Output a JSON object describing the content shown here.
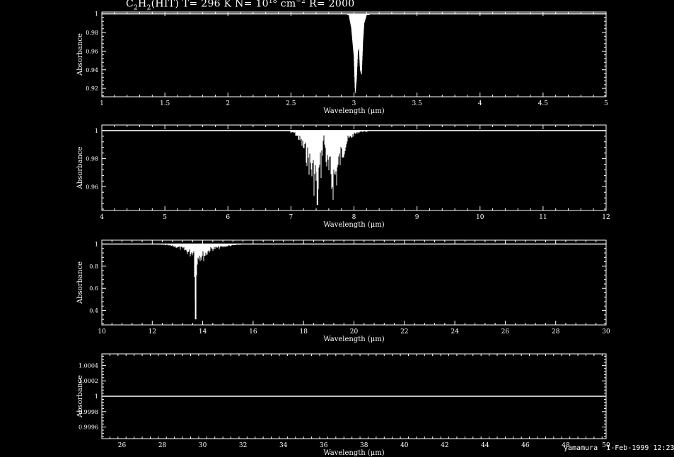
{
  "title": {
    "molecule_prefix": "C",
    "sub1": "2",
    "mid1": "H",
    "sub2": "2",
    "rest1": "(HIT) T= 296 K N= 10",
    "exp": "18",
    "rest2": " cm",
    "exp2": "−2",
    "rest3": " R= 2000"
  },
  "footer": {
    "user": "yamamura",
    "date": "1-Feb-1999 12:23"
  },
  "colors": {
    "background": "#000000",
    "foreground": "#ffffff"
  },
  "chart_data": [
    {
      "type": "line",
      "xlabel": "Wavelength (μm)",
      "ylabel": "Absorbance",
      "xlim": [
        1,
        5
      ],
      "ylim": [
        0.911,
        1.002
      ],
      "xticks": [
        "1",
        "1.5",
        "2",
        "2.5",
        "3",
        "3.5",
        "4",
        "4.5",
        "5"
      ],
      "yticks": [
        "0.92",
        "0.94",
        "0.96",
        "0.98",
        "1"
      ],
      "yticks_values": [
        0.92,
        0.94,
        0.96,
        0.98,
        1
      ],
      "baseline": 1,
      "spectrum": {
        "envelope_type": "narrow",
        "range": [
          2.95,
          3.12
        ],
        "x": [
          2.96,
          2.98,
          3.0,
          3.01,
          3.02,
          3.03,
          3.04,
          3.05,
          3.06,
          3.07,
          3.08,
          3.1
        ],
        "y": [
          0.999,
          0.985,
          0.955,
          0.915,
          0.93,
          0.96,
          0.965,
          0.94,
          0.935,
          0.97,
          0.99,
          0.999
        ]
      }
    },
    {
      "type": "line",
      "xlabel": "Wavelength (μm)",
      "ylabel": "Absorbance",
      "xlim": [
        4,
        12
      ],
      "ylim": [
        0.943,
        1.004
      ],
      "xticks": [
        "4",
        "5",
        "6",
        "7",
        "8",
        "9",
        "10",
        "11",
        "12"
      ],
      "yticks": [
        "0.96",
        "0.98",
        "1"
      ],
      "yticks_values": [
        0.96,
        0.98,
        1
      ],
      "baseline": 1,
      "spectrum": {
        "envelope_type": "dense",
        "range": [
          7.0,
          8.2
        ],
        "x": [
          7.05,
          7.15,
          7.25,
          7.35,
          7.42,
          7.48,
          7.52,
          7.58,
          7.65,
          7.72,
          7.8,
          7.9,
          8.0,
          8.1
        ],
        "y": [
          0.998,
          0.99,
          0.975,
          0.955,
          0.947,
          0.965,
          0.995,
          0.96,
          0.947,
          0.955,
          0.975,
          0.99,
          0.996,
          0.999
        ]
      }
    },
    {
      "type": "line",
      "xlabel": "Wavelength (μm)",
      "ylabel": "Absorbance",
      "xlim": [
        10,
        30
      ],
      "ylim": [
        0.27,
        1.035
      ],
      "xticks": [
        "10",
        "12",
        "14",
        "16",
        "18",
        "20",
        "22",
        "24",
        "26",
        "28",
        "30"
      ],
      "yticks": [
        "0.4",
        "0.6",
        "0.8",
        "1"
      ],
      "yticks_values": [
        0.4,
        0.6,
        0.8,
        1
      ],
      "baseline": 1,
      "spectrum": {
        "envelope_type": "dense",
        "range": [
          12.0,
          15.8
        ],
        "x": [
          12.2,
          12.6,
          13.0,
          13.3,
          13.5,
          13.65,
          13.72,
          13.8,
          14.0,
          14.3,
          14.6,
          15.0,
          15.4,
          15.7
        ],
        "y": [
          0.995,
          0.985,
          0.96,
          0.92,
          0.88,
          0.9,
          0.32,
          0.86,
          0.83,
          0.93,
          0.95,
          0.975,
          0.99,
          0.998
        ]
      }
    },
    {
      "type": "line",
      "xlabel": "Wavelength (μm)",
      "ylabel": "Absorbance",
      "xlim": [
        25,
        50
      ],
      "ylim": [
        0.99945,
        1.00055
      ],
      "xticks": [
        "26",
        "28",
        "30",
        "32",
        "34",
        "36",
        "38",
        "40",
        "42",
        "44",
        "46",
        "48",
        "50"
      ],
      "yticks": [
        "0.9996",
        "0.9998",
        "1",
        "1.0002",
        "1.0004"
      ],
      "yticks_values": [
        0.9996,
        0.9998,
        1,
        1.0002,
        1.0004
      ],
      "baseline": 1
    }
  ]
}
